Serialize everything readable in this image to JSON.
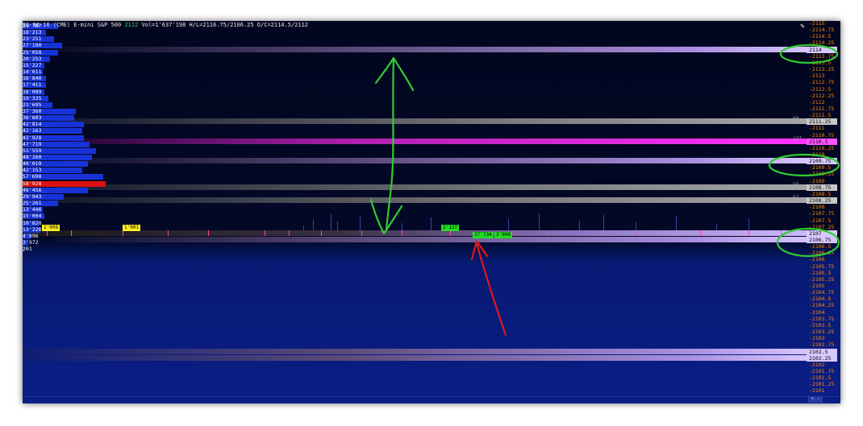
{
  "title_bar": {
    "symbol_text": "ES 06-16 (CME) E-mini S&P 500",
    "last_price": "2112",
    "stats_text": "Vol=1'637'198 H/L=2116.75/2106.25 O/C=2114.5/2112"
  },
  "volume_profile": [
    {
      "label": "29'787",
      "level": 0.18,
      "color": "#1733d8"
    },
    {
      "label": "18'213",
      "level": 0.12,
      "color": "#1733d8"
    },
    {
      "label": "23'251",
      "level": 0.16,
      "color": "#1733d8"
    },
    {
      "label": "27'190",
      "level": 0.2,
      "color": "#1733d8"
    },
    {
      "label": "25'058",
      "level": 0.18,
      "color": "#1733d8"
    },
    {
      "label": "20'253",
      "level": 0.14,
      "color": "#1733d8"
    },
    {
      "label": "15'227",
      "level": 0.11,
      "color": "#1733d8"
    },
    {
      "label": "14'011",
      "level": 0.1,
      "color": "#1733d8"
    },
    {
      "label": "16'840",
      "level": 0.12,
      "color": "#1733d8"
    },
    {
      "label": "17'411",
      "level": 0.12,
      "color": "#1733d8"
    },
    {
      "label": "16'089",
      "level": 0.11,
      "color": "#1733d8"
    },
    {
      "label": "19'335",
      "level": 0.13,
      "color": "#1733d8"
    },
    {
      "label": "21'695",
      "level": 0.15,
      "color": "#1733d8"
    },
    {
      "label": "37'360",
      "level": 0.27,
      "color": "#1733d8"
    },
    {
      "label": "36'603",
      "level": 0.26,
      "color": "#1733d8"
    },
    {
      "label": "42'814",
      "level": 0.31,
      "color": "#1733d8"
    },
    {
      "label": "42'163",
      "level": 0.3,
      "color": "#1733d8"
    },
    {
      "label": "42'928",
      "level": 0.31,
      "color": "#1733d8"
    },
    {
      "label": "47'719",
      "level": 0.34,
      "color": "#1733d8"
    },
    {
      "label": "51'559",
      "level": 0.37,
      "color": "#1733d8"
    },
    {
      "label": "48'260",
      "level": 0.35,
      "color": "#1733d8"
    },
    {
      "label": "46'019",
      "level": 0.33,
      "color": "#1733d8"
    },
    {
      "label": "42'153",
      "level": 0.3,
      "color": "#1733d8"
    },
    {
      "label": "57'698",
      "level": 0.41,
      "color": "#1733d8"
    },
    {
      "label": "58'928",
      "level": 0.42,
      "color": "#dd1111"
    },
    {
      "label": "46'456",
      "level": 0.33,
      "color": "#1733d8"
    },
    {
      "label": "29'943",
      "level": 0.21,
      "color": "#1733d8"
    },
    {
      "label": "25'261",
      "level": 0.18,
      "color": "#1733d8"
    },
    {
      "label": "13'446",
      "level": 0.1,
      "color": "#1733d8"
    },
    {
      "label": "15'004",
      "level": 0.11,
      "color": "#1733d8"
    },
    {
      "label": "10'828",
      "level": 0.08,
      "color": "#1733d8"
    },
    {
      "label": "13'220",
      "level": 0.09,
      "color": "#1733d8"
    },
    {
      "label": "4'896",
      "level": 0.04,
      "color": "#1733d8"
    },
    {
      "label": "3'972",
      "level": 0.03,
      "color": "#1733d8"
    },
    {
      "label": "201",
      "level": 0.01,
      "color": "#1733d8"
    }
  ],
  "price_axis": [
    "2115",
    "2114.75",
    "2114.5",
    "2114.25",
    "2114",
    "2113.75",
    "2113.5",
    "2113.25",
    "2113",
    "2112.75",
    "2112.5",
    "2112.25",
    "2112",
    "2111.75",
    "2111.5",
    "2111.25",
    "2111",
    "2110.75",
    "2110.5",
    "2110.25",
    "2110",
    "2109.75",
    "2109.5",
    "2109.25",
    "2109",
    "2108.75",
    "2108.5",
    "2108.25",
    "2108",
    "2107.75",
    "2107.5",
    "2107.25",
    "2107",
    "2106.75",
    "2106.5",
    "2106.25",
    "2106",
    "2105.75",
    "2105.5",
    "2105.25",
    "2105",
    "2104.75",
    "2104.5",
    "2104.25",
    "2104",
    "2103.75",
    "2103.5",
    "2103.25",
    "2103",
    "2102.75",
    "2102.5",
    "2102.25",
    "2102",
    "2101.75",
    "2101.5",
    "2101.25",
    "2101"
  ],
  "highlighted_prices": [
    {
      "price": "2114",
      "style": "lavender"
    },
    {
      "price": "2111.25",
      "style": "grey"
    },
    {
      "price": "2110.5",
      "style": "magenta"
    },
    {
      "price": "2109.75",
      "style": "lavender"
    },
    {
      "price": "2108.75",
      "style": "grey"
    },
    {
      "price": "2108.25",
      "style": "grey"
    },
    {
      "price": "2107",
      "style": "lavender"
    },
    {
      "price": "2106.75",
      "style": "lavender"
    },
    {
      "price": "2102.5",
      "style": "lavender"
    },
    {
      "price": "2102.25",
      "style": "lavender"
    }
  ],
  "side_numbers": [
    {
      "price": "2111.25",
      "value": "60"
    },
    {
      "price": "2110.5",
      "value": "137"
    },
    {
      "price": "2108.75",
      "value": "58"
    },
    {
      "price": "2108.25",
      "value": "67"
    }
  ],
  "orders": [
    {
      "label": "1'008",
      "color": "yellow"
    },
    {
      "label": "1'001",
      "color": "yellow"
    },
    {
      "label": "2'137",
      "color": "green"
    },
    {
      "label": "27'734",
      "color": "green"
    },
    {
      "label": "3'098",
      "color": "green"
    }
  ],
  "scroll_label": "+ -",
  "annotation_colors": {
    "green": "#2fcc2f",
    "red": "#e01818"
  }
}
